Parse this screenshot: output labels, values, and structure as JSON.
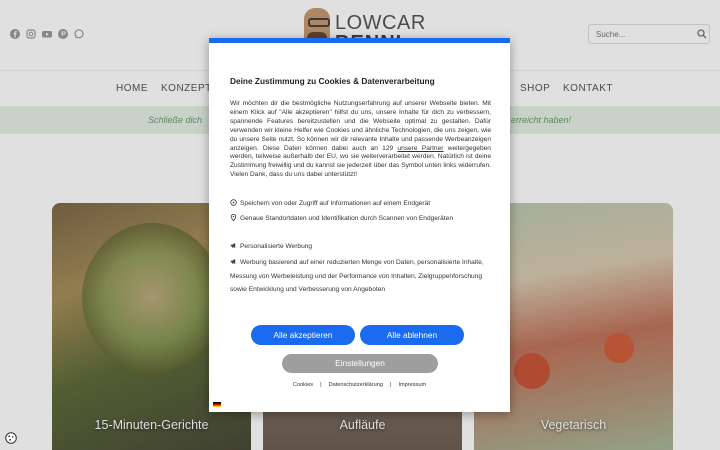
{
  "site": {
    "logo": {
      "line1": "LOWCARB",
      "line2": "BENNI"
    },
    "search": {
      "placeholder": "Suche..."
    },
    "social_icons": [
      "facebook-icon",
      "instagram-icon",
      "youtube-icon",
      "pinterest-icon",
      "whatsapp-icon"
    ],
    "nav": {
      "items": [
        "HOME",
        "KONZEPT",
        "SHOP",
        "KONTAKT"
      ]
    },
    "banner": {
      "left": "Schließe dich",
      "right": "erreicht haben!"
    },
    "cards": [
      {
        "label": "15-Minuten-Gerichte"
      },
      {
        "label": "Aufläufe"
      },
      {
        "label": "Vegetarisch"
      }
    ],
    "colors": {
      "accent": "#1a6bf0",
      "banner_bg": "#e4efe4",
      "settings_button": "#9e9e9e"
    }
  },
  "consent": {
    "title": "Deine Zustimmung zu Cookies & Datenverarbeitung",
    "intro_before_link": "Wir möchten dir die bestmögliche Nutzungserfahrung auf unserer Webseite bieten. Mit einem Klick auf \"Alle akzeptieren\" hilfst du uns, unsere Inhalte für dich zu verbessern, spannende Features bereitzustellen und die Webseite optimal zu gestalten. Dafür verwenden wir kleine Helfer wie Cookies und ähnliche Technologien, die uns zeigen, wie du unsere Seite nutzt. So können wir dir relevante Inhalte und passende Werbeanzeigen anzeigen. Diese Daten können dabei auch an 129",
    "partners_link": "unsere Partner",
    "intro_after_link": "weitergegeben werden, teilweise außerhalb der EU, wo sie weiterverarbeitet werden. Natürlich ist deine Zustimmung freiwillig und du kannst sie jederzeit über das Symbol unten links widerrufen. Vielen Dank, dass du uns dabei unterstützt!",
    "purposes": [
      {
        "icon": "storage-icon",
        "text": "Speichern von oder Zugriff auf Informationen auf einem Endgerät"
      },
      {
        "icon": "location-pin-icon",
        "text": "Genaue Standortdaten und Identifikation durch Scannen von Endgeräten"
      },
      {
        "icon": "megaphone-icon",
        "text": "Personalisierte Werbung"
      },
      {
        "icon": "megaphone-icon",
        "text": "Werbung basierend auf einer reduzierten Menge von Daten, personalisierte Inhalte, Messung von Werbeleistung und der Performance von Inhalten, Zielgruppenforschung sowie Entwicklung und Verbesserung von Angeboten"
      }
    ],
    "accept_all": "Alle akzeptieren",
    "reject_all": "Alle ablehnen",
    "settings": "Einstellungen",
    "footer_links": [
      "Cookies",
      "Datenschutzerklärung",
      "Impressum"
    ],
    "footer_separator": "|"
  }
}
